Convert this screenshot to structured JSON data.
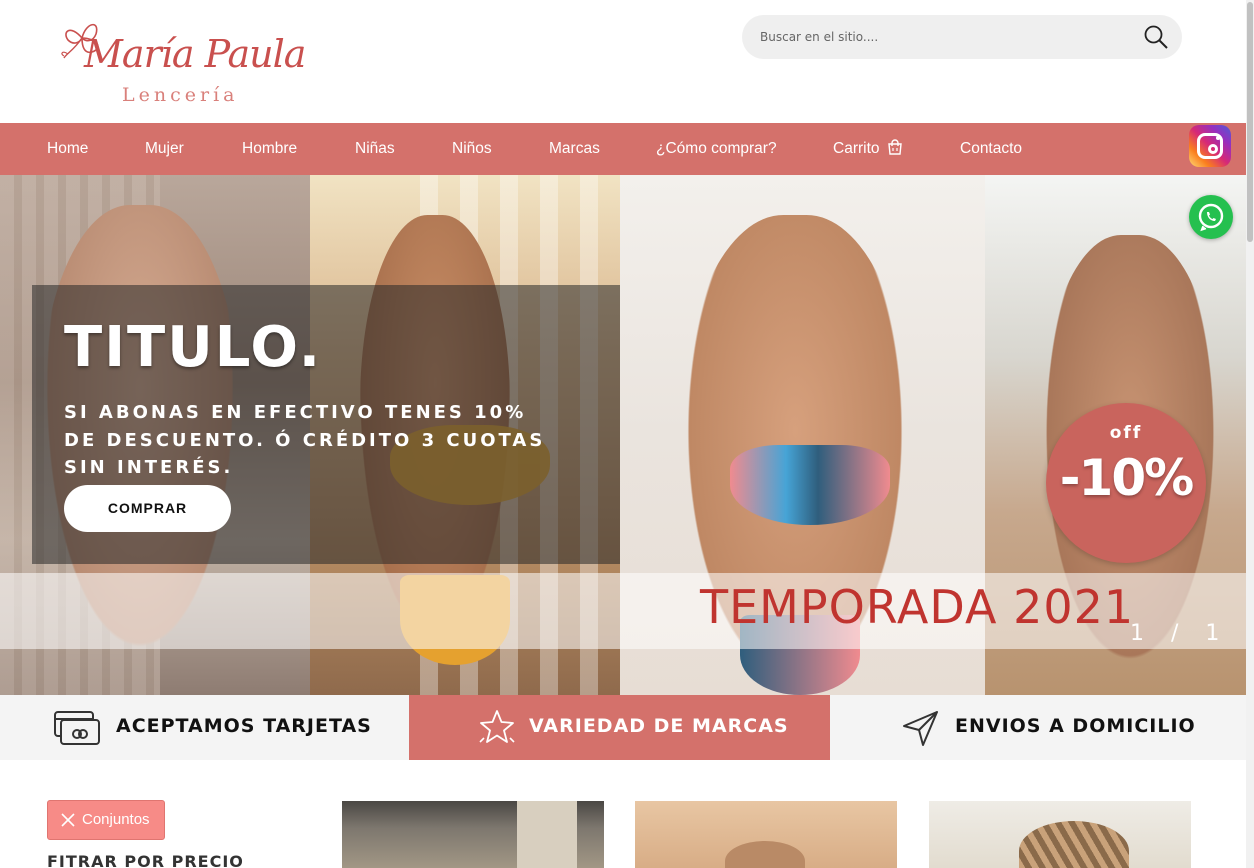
{
  "brand": {
    "logo_script": "María Paula",
    "logo_sub": "Lencería",
    "accent": "#d4716b",
    "logo_color": "#c9504e"
  },
  "search": {
    "placeholder": "Buscar en el sitio....",
    "value": "",
    "icon": "search-icon"
  },
  "nav": {
    "items": [
      {
        "label": "Home"
      },
      {
        "label": "Mujer"
      },
      {
        "label": "Hombre"
      },
      {
        "label": "Niñas"
      },
      {
        "label": "Niños"
      },
      {
        "label": "Marcas"
      },
      {
        "label": "¿Cómo comprar?"
      },
      {
        "label": "Carrito",
        "icon": "shopping-bag-icon"
      },
      {
        "label": "Contacto"
      }
    ]
  },
  "social": {
    "instagram_icon": "instagram-icon",
    "whatsapp_icon": "whatsapp-icon"
  },
  "hero": {
    "title": "TITULO.",
    "text": "SI ABONAS EN EFECTIVO TENES 10% DE DESCUENTO. Ó CRÉDITO 3 CUOTAS SIN INTERÉS.",
    "button_label": "COMPRAR",
    "banner_text": "TEMPORADA 2021",
    "badge_label": "off",
    "badge_value": "-10%",
    "pager": "1 / 1"
  },
  "features": [
    {
      "label": "ACEPTAMOS TARJETAS",
      "icon": "credit-card-icon"
    },
    {
      "label": "VARIEDAD DE MARCAS",
      "icon": "star-icon"
    },
    {
      "label": "ENVIOS A DOMICILIO",
      "icon": "send-icon"
    }
  ],
  "filters": {
    "active_chip": "Conjuntos",
    "section_title": "FITRAR POR PRECIO"
  }
}
